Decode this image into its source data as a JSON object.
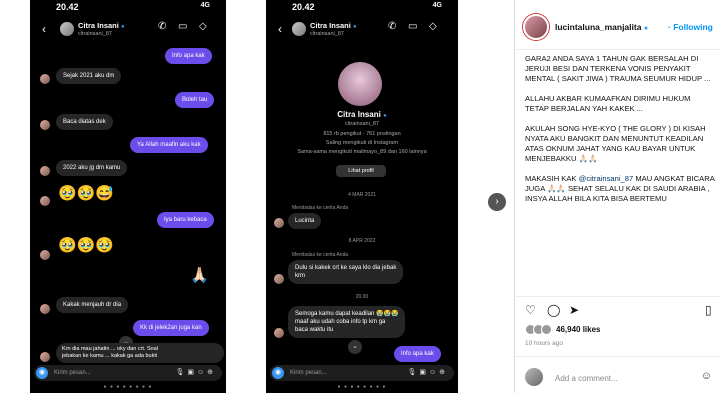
{
  "phone1": {
    "time": "20.42",
    "signal": "4G",
    "name": "Citra Insani",
    "handle": "citrainsani_87",
    "messages": {
      "m1": "Info apa kak",
      "m2": "Sejak 2021 aku dm",
      "m3": "Boleh tau",
      "m4": "Baca diatas dek",
      "m5": "Ya Allah maafin aku kak",
      "m6": "2022 aku jg dm kamu",
      "m7": "Iya baru kebaca",
      "m8": "Kakak menjauh dr dia",
      "m9": "Kk di jelek2an juga kan",
      "m10a": "Krn dia mau jahatin ... oky dan crt. Soal",
      "m10b": "jebakan ke kamu ... kakak ga ada bukti"
    },
    "emoji_row1": "🥹🥹😅",
    "emoji_row2": "🥹🥹🥹",
    "emoji_pray": "🙏🏻",
    "input_placeholder": "Kirim pesan...",
    "icons": {
      "back": "chevron-left-icon",
      "call": "phone-icon",
      "video": "video-icon",
      "tag": "tag-icon",
      "camera": "camera-icon"
    }
  },
  "phone2": {
    "time": "20.42",
    "signal": "4G",
    "name": "Citra Insani",
    "handle": "citrainsani_87",
    "profile_name": "Citra Insani",
    "profile_handle": "citrainsani_87",
    "stats": "815 rb pengikut · 761 postingan",
    "mutual1": "Saling mengikuti di Instagram",
    "mutual2": "Sama-sama mengikuti mailmayo_89 dan 160 lainnya",
    "view_profile": "Lihat profil",
    "date1": "4 MAR 2021",
    "mention1": "Membalas ke cerita Anda",
    "msg1": "Lucinta",
    "date2": "8 APR 2022",
    "mention2": "Membalas ke cerita Anda",
    "msg2a": "Dulu si kakek crt ke saya klo dia jebak",
    "msg2b": "krm",
    "time3": "20.00",
    "msg3a": "Semoga kamu dapat keadilan 😭😭😭",
    "msg3b": "maaf aku udah coba info tp km ga",
    "msg3c": "baca waktu itu",
    "msg4": "Info apa kak",
    "input_placeholder": "Kirim pesan..."
  },
  "post": {
    "username": "lucintaluna_manjalita",
    "follow_label": "Following",
    "caption": [
      "GARA2 ANDA SAYA 1 TAHUN GAK BERSALAH DI JERUJI BESI DAN TERKENA VONIS PENYAKIT MENTAL ( SAKIT JIWA ) TRAUMA SEUMUR HIDUP ...",
      "ALLAHU AKBAR KUMAAFKAN DIRIMU HUKUM TETAP BERJALAN YAH KAKEK ...",
      "AKULAH SONG HYE-KYO ( THE GLORY ) DI KISAH NYATA AKU BANGKIT DAN MENUNTUT KEADILAN ATAS OKNUM JAHAT YANG KAU BAYAR UNTUK MENJEBAKKU 🙏🏻🙏🏻",
      "MAKASIH KAK",
      "@citrainsani_87",
      "MAU ANGKAT BICARA JUGA 🙏🏻🙏🏻 SEHAT SELALU KAK DI SAUDI ARABIA , INSYA ALLAH BILA KITA BISA BERTEMU"
    ],
    "likes": "46,940 likes",
    "time": "10 hours ago",
    "comment_placeholder": "Add a comment...",
    "icons": {
      "like": "heart-icon",
      "comment": "comment-icon",
      "share": "send-icon",
      "save": "bookmark-icon",
      "emoji": "smiley-icon",
      "verified": "verified-badge-icon"
    }
  },
  "carousel_next": "›"
}
